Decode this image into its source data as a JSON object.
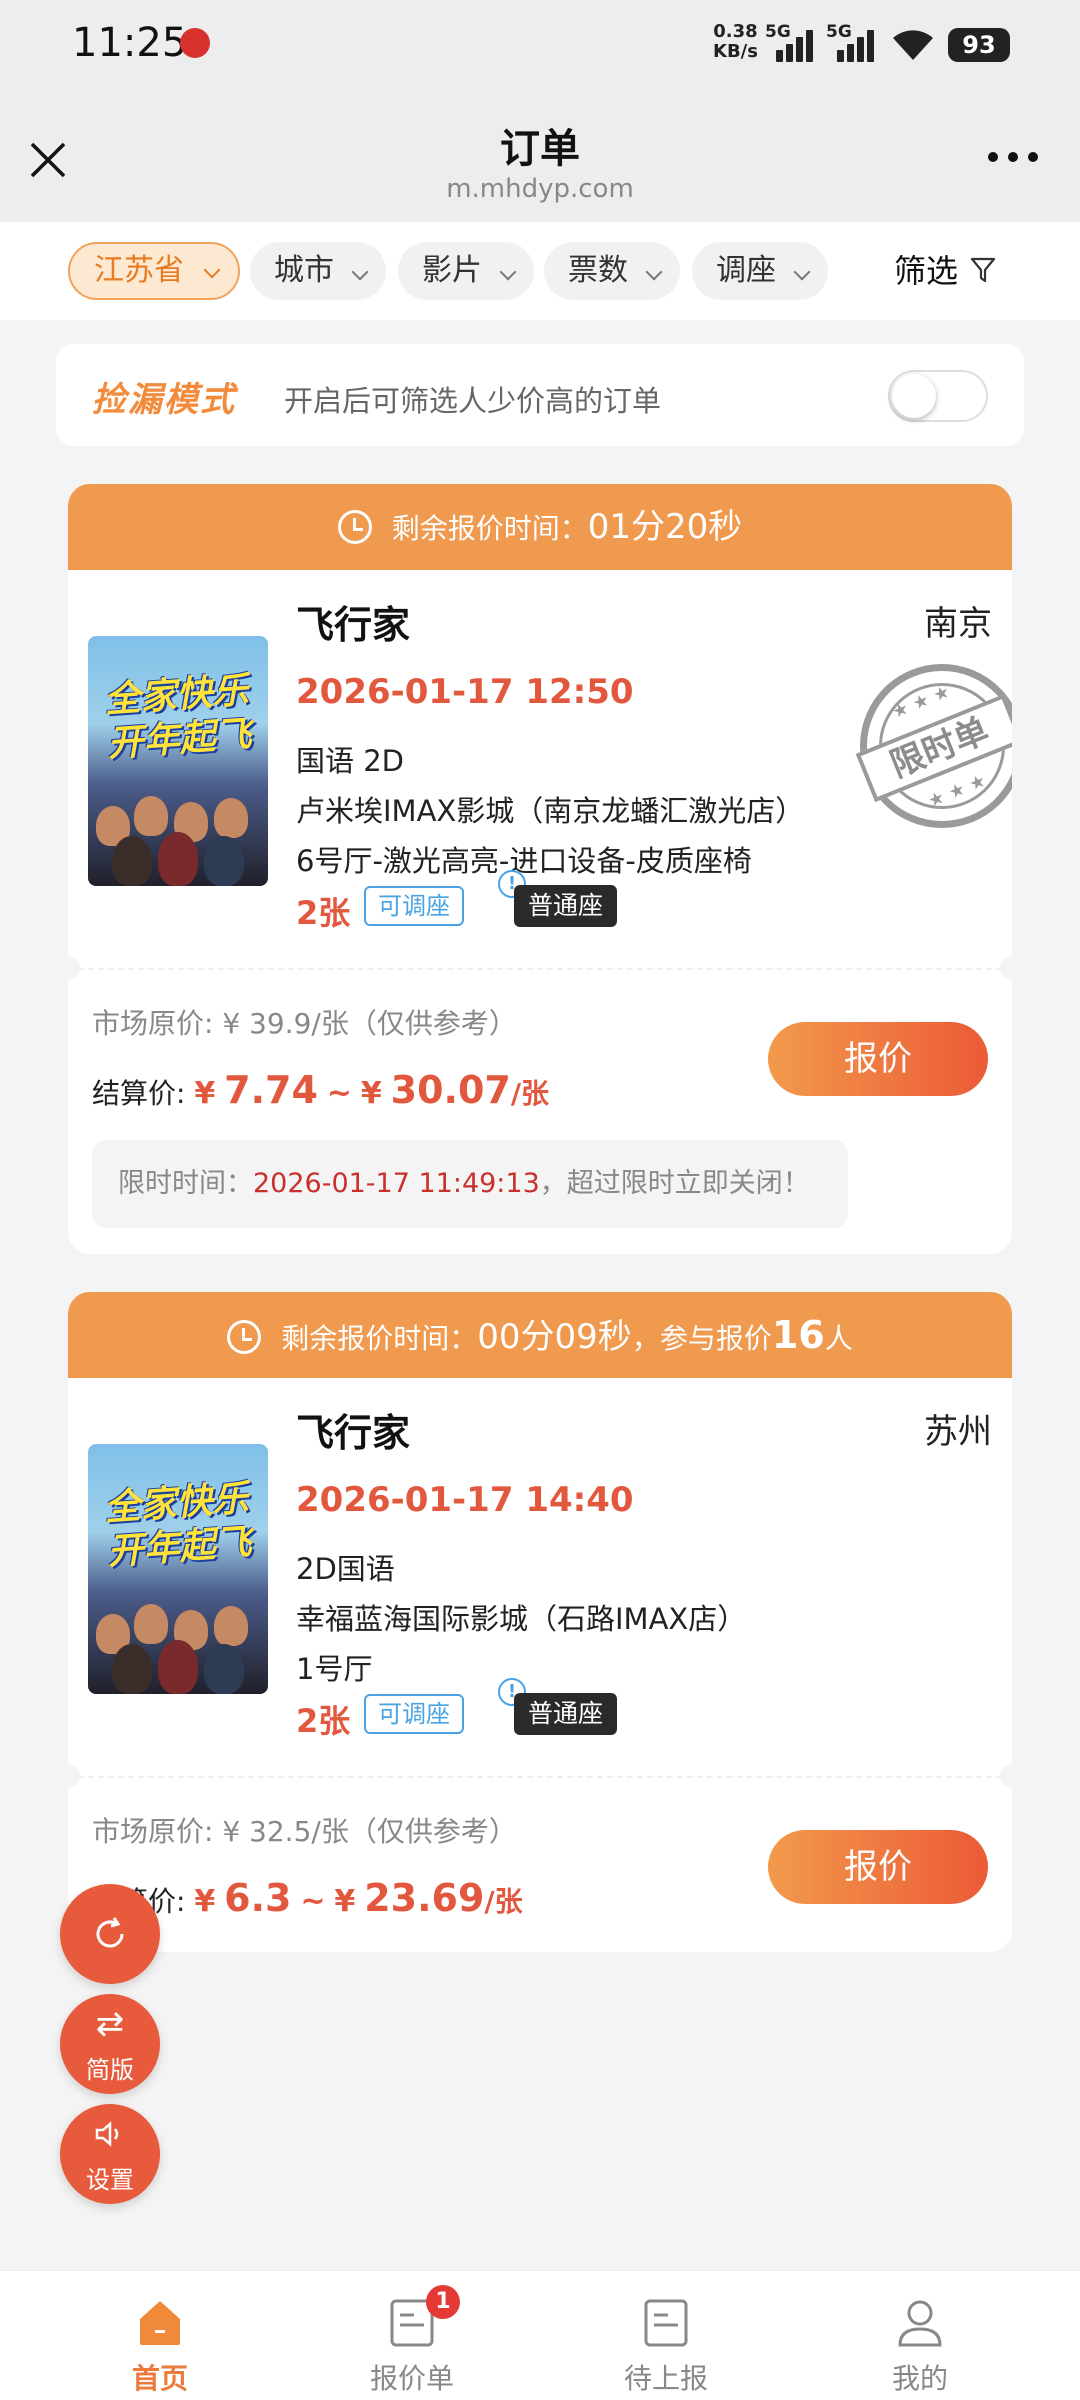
{
  "status_bar": {
    "time": "11:25",
    "speed_value": "0.38",
    "speed_unit": "KB/s",
    "network1": "5G",
    "network2": "5G",
    "battery": "93"
  },
  "header": {
    "title": "订单",
    "subtitle": "m.mhdyp.com"
  },
  "filters": {
    "chips": [
      "江苏省",
      "城市",
      "影片",
      "票数",
      "调座"
    ],
    "filter_label": "筛选"
  },
  "leak_mode": {
    "title": "捡漏模式",
    "description": "开启后可筛选人少价高的订单",
    "enabled": false
  },
  "orders": [
    {
      "countdown_label": "剩余报价时间：",
      "countdown_value": "01分20秒",
      "title": "飞行家",
      "city": "南京",
      "datetime": "2026-01-17 12:50",
      "format": "国语 2D",
      "cinema": "卢米埃IMAX影城（南京龙蟠汇激光店）",
      "hall": "6号厅-激光高亮-进口设备-皮质座椅",
      "tickets": "2张",
      "adjust_tag": "可调座",
      "seat_tag": "普通座",
      "stamp": "限时单",
      "poster_text": "全家快乐开年起飞",
      "market_price": "市场原价: ¥ 39.9/张（仅供参考）",
      "settle_label": "结算价:",
      "price_min_symbol": "¥",
      "price_min": "7.74",
      "price_sep": "~",
      "price_max_symbol": "¥",
      "price_max": "30.07",
      "price_unit": "/张",
      "quote_button": "报价",
      "limit_label": "限时时间：",
      "limit_time": "2026-01-17 11:49:13",
      "limit_suffix": "，超过限时立即关闭！"
    },
    {
      "countdown_label": "剩余报价时间：",
      "countdown_value": "00分09秒",
      "participants_prefix": "，参与报价",
      "participants_count": "16",
      "participants_suffix": "人",
      "title": "飞行家",
      "city": "苏州",
      "datetime": "2026-01-17 14:40",
      "format": "2D国语",
      "cinema": "幸福蓝海国际影城（石路IMAX店）",
      "hall": "1号厅",
      "tickets": "2张",
      "adjust_tag": "可调座",
      "seat_tag": "普通座",
      "poster_text": "全家快乐开年起飞",
      "market_price": "市场原价: ¥ 32.5/张（仅供参考）",
      "settle_label": "结算价:",
      "price_min_symbol": "¥",
      "price_min": "6.3",
      "price_sep": "~",
      "price_max_symbol": "¥",
      "price_max": "23.69",
      "price_unit": "/张",
      "quote_button": "报价"
    }
  ],
  "floating_buttons": {
    "refresh_icon": "refresh-icon",
    "simple_label": "简版",
    "settings_label": "设置"
  },
  "bottom_nav": {
    "items": [
      {
        "label": "首页",
        "icon": "home-icon"
      },
      {
        "label": "报价单",
        "icon": "document-icon",
        "badge": "1"
      },
      {
        "label": "待上报",
        "icon": "document-icon"
      },
      {
        "label": "我的",
        "icon": "user-icon"
      }
    ]
  },
  "colors": {
    "accent_orange": "#f09a4f",
    "price_red": "#e2583e",
    "tag_blue": "#4aa3e3"
  }
}
